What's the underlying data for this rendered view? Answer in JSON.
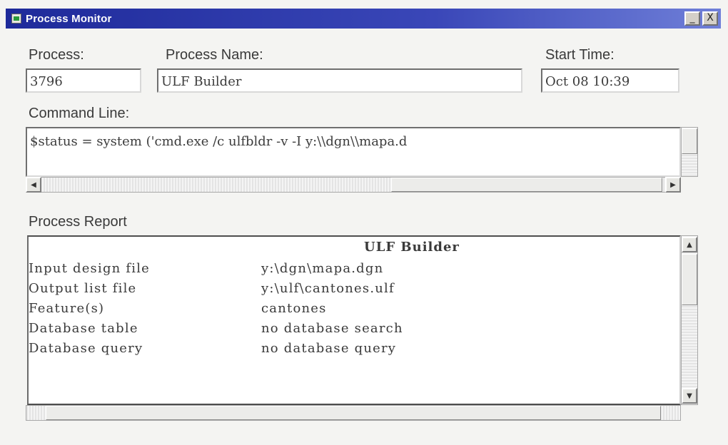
{
  "window": {
    "title": "Process Monitor",
    "minimize_label": "_",
    "close_label": "X"
  },
  "process": {
    "label": "Process:",
    "value": "3796"
  },
  "process_name": {
    "label": "Process Name:",
    "value": "ULF Builder"
  },
  "start_time": {
    "label": "Start Time:",
    "value": "Oct 08 10:39"
  },
  "command_line": {
    "label": "Command Line:",
    "value": "$status = system ('cmd.exe /c ulfbldr -v -I y:\\\\dgn\\\\mapa.d"
  },
  "report": {
    "label": "Process Report",
    "title": "ULF Builder",
    "rows": [
      {
        "key": "Input design file",
        "value": "y:\\dgn\\mapa.dgn"
      },
      {
        "key": "Output list file",
        "value": "y:\\ulf\\cantones.ulf"
      },
      {
        "key": "Feature(s)",
        "value": "cantones"
      },
      {
        "key": "Database table",
        "value": "no database search"
      },
      {
        "key": "Database query",
        "value": "no database query"
      }
    ]
  },
  "icons": {
    "app": "process-monitor-icon",
    "scroll_up": "arrow-up-icon",
    "scroll_down": "arrow-down-icon",
    "scroll_left": "arrow-left-icon",
    "scroll_right": "arrow-right-icon"
  },
  "colors": {
    "titlebar": "#1e2a9a",
    "background": "#f4f4f2"
  }
}
